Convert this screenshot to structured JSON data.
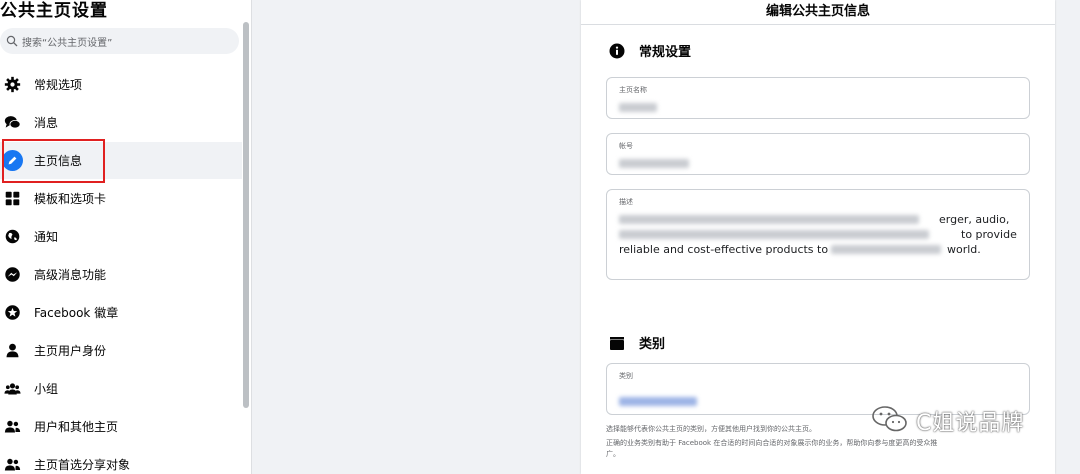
{
  "sidebar": {
    "title": "公共主页设置",
    "search_placeholder": "搜索“公共主页设置”",
    "items": [
      {
        "label": "常规选项",
        "icon": "gear-icon"
      },
      {
        "label": "消息",
        "icon": "chat-bubbles-icon"
      },
      {
        "label": "主页信息",
        "icon": "pencil-icon",
        "active": true
      },
      {
        "label": "模板和选项卡",
        "icon": "grid-icon"
      },
      {
        "label": "通知",
        "icon": "globe-icon"
      },
      {
        "label": "高级消息功能",
        "icon": "messenger-icon"
      },
      {
        "label": "Facebook 徽章",
        "icon": "badge-icon"
      },
      {
        "label": "主页用户身份",
        "icon": "person-icon"
      },
      {
        "label": "小组",
        "icon": "group-icon"
      },
      {
        "label": "用户和其他主页",
        "icon": "people-icon"
      },
      {
        "label": "主页首选分享对象",
        "icon": "people-icon"
      }
    ]
  },
  "panel": {
    "title": "编辑公共主页信息",
    "general_section": "常规设置",
    "name_label": "主页名称",
    "username_label": "帐号",
    "description_label": "描述",
    "description_visible": [
      "erger, audio,",
      "to provide",
      "reliable and cost-effective products to",
      "world."
    ],
    "category_section": "类别",
    "category_label": "类别",
    "hint_line1": "选择能够代表你公共主页的类别，方便其他用户找到你的公共主页。",
    "hint_line2": "正确的业务类别有助于 Facebook 在合适的时间向合适的对象展示你的业务，帮助你向参与度更高的受众推",
    "hint_line3": "广。"
  },
  "watermark": {
    "text": "C姐说品牌"
  },
  "colors": {
    "accent": "#1877f2",
    "highlight_box": "#e02020"
  }
}
